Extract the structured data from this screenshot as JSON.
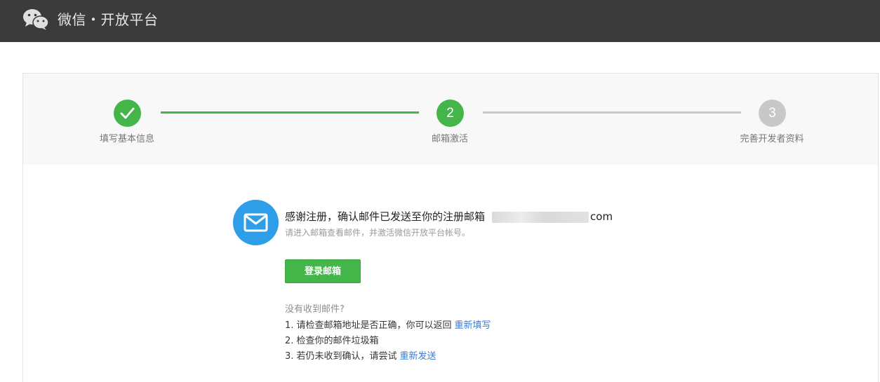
{
  "header": {
    "title": "微信・开放平台",
    "logo_icon": "wechat-logo-icon",
    "background": "#3b3b3b"
  },
  "steps": [
    {
      "number": "",
      "label": "填写基本信息",
      "state": "done",
      "icon": "check-icon"
    },
    {
      "number": "2",
      "label": "邮箱激活",
      "state": "active"
    },
    {
      "number": "3",
      "label": "完善开发者资料",
      "state": "pending"
    }
  ],
  "colors": {
    "accent_green": "#44b549",
    "pending_gray": "#c8c8c8",
    "mail_blue": "#2f9ee8",
    "link_blue": "#3b7bd1"
  },
  "message": {
    "icon": "envelope-icon",
    "line1_prefix": "感谢注册，确认邮件已发送至你的注册邮箱",
    "email_suffix": "com",
    "line2": "请进入邮箱查看邮件，并激活微信开放平台帐号。"
  },
  "login_button": {
    "label": "登录邮箱"
  },
  "help": {
    "title": "没有收到邮件?",
    "item1_text": "1. 请检查邮箱地址是否正确，你可以返回",
    "item1_link": "重新填写",
    "item2_text": "2. 检查你的邮件垃圾箱",
    "item3_text": "3. 若仍未收到确认，请尝试",
    "item3_link": "重新发送"
  }
}
